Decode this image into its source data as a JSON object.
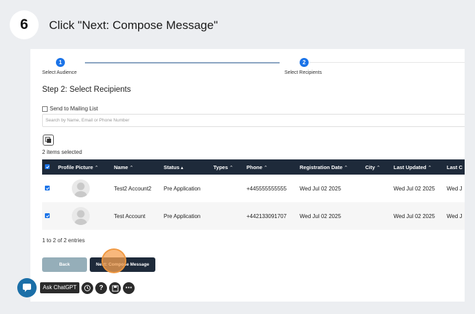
{
  "step": {
    "number": "6",
    "title": "Click \"Next: Compose Message\""
  },
  "wizard": {
    "steps": [
      {
        "number": "1",
        "label": "Select Audience"
      },
      {
        "number": "2",
        "label": "Select Recipients"
      }
    ],
    "section_title": "Step 2: Select Recipients",
    "mailing_list_label": "Send to Mailing List",
    "search_placeholder": "Search by Name, Email or Phone Number",
    "selected_count": "2 items selected",
    "columns": [
      "Profile Picture",
      "Name",
      "Status",
      "Types",
      "Phone",
      "Registration Date",
      "City",
      "Last Updated",
      "Last C"
    ],
    "rows": [
      {
        "name": "Test2 Account2",
        "status": "Pre Application",
        "types": "",
        "phone": "+445555555555",
        "registration_date": "Wed Jul 02 2025",
        "city": "",
        "last_updated": "Wed Jul 02 2025",
        "last_c": "Wed J"
      },
      {
        "name": "Test Account",
        "status": "Pre Application",
        "types": "",
        "phone": "+442133091707",
        "registration_date": "Wed Jul 02 2025",
        "city": "",
        "last_updated": "Wed Jul 02 2025",
        "last_c": "Wed J"
      }
    ],
    "entries_text": "1 to 2 of 2 entries",
    "back_label": "Back",
    "next_label": "Next: Compose Message"
  },
  "toolbar": {
    "ask_label": "Ask ChatGPT"
  },
  "colors": {
    "accent": "#1a73e8",
    "header_bg": "#1e2a3a",
    "back_btn": "#95aeb9",
    "highlight": "#f5a050"
  }
}
